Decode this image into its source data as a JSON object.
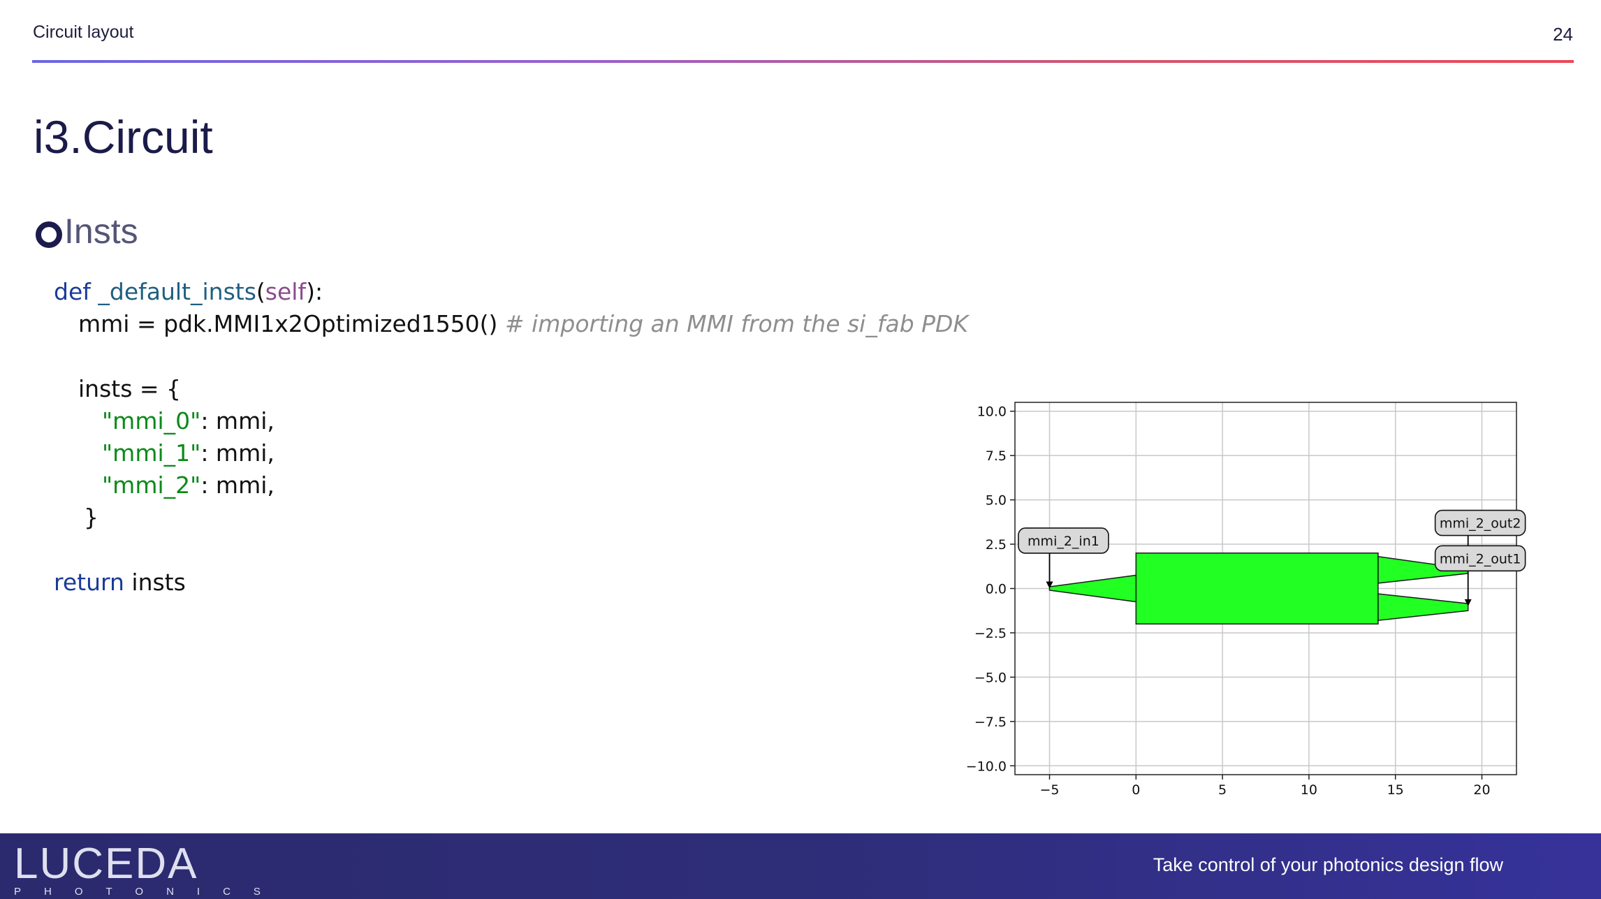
{
  "header": {
    "title": "Circuit layout",
    "page_number": "24"
  },
  "slide_title": "i3.Circuit",
  "section": {
    "heading": "Insts"
  },
  "code": {
    "l1_kw": "def",
    "l1_fn": "_default_insts",
    "l1_p1": "(",
    "l1_self": "self",
    "l1_p2": "):",
    "l2_code": "mmi = pdk.MMI1x2Optimized1550() ",
    "l2_comment": "# importing an MMI from the si_fab PDK",
    "l4": "insts = {",
    "l5_str": "\"mmi_0\"",
    "l5_rest": ": mmi,",
    "l6_str": "\"mmi_1\"",
    "l6_rest": ": mmi,",
    "l7_str": "\"mmi_2\"",
    "l7_rest": ": mmi,",
    "l8": "}",
    "l10_kw": "return",
    "l10_rest": " insts"
  },
  "chart_data": {
    "type": "layout-plot",
    "xlim": [
      -7,
      22
    ],
    "ylim": [
      -10.5,
      10.5
    ],
    "x_ticks": [
      -5,
      0,
      5,
      10,
      15,
      20
    ],
    "x_tick_labels": [
      "−5",
      "0",
      "5",
      "10",
      "15",
      "20"
    ],
    "y_ticks": [
      10,
      7.5,
      5,
      2.5,
      0,
      -2.5,
      -5,
      -7.5,
      -10
    ],
    "y_tick_labels": [
      "10.0",
      "7.5",
      "5.0",
      "2.5",
      "0.0",
      "−2.5",
      "−5.0",
      "−7.5",
      "−10.0"
    ],
    "grid": true,
    "fill_color": "#22ff22",
    "shapes": [
      {
        "name": "mmi-body",
        "points": [
          [
            0,
            2
          ],
          [
            14,
            2
          ],
          [
            14,
            -2
          ],
          [
            0,
            -2
          ]
        ]
      },
      {
        "name": "input-taper",
        "points": [
          [
            -5,
            0.1
          ],
          [
            0,
            0.75
          ],
          [
            0,
            -0.75
          ],
          [
            -5,
            -0.1
          ]
        ]
      },
      {
        "name": "output-taper-top",
        "points": [
          [
            14,
            1.8
          ],
          [
            19.2,
            1.1
          ],
          [
            19.2,
            0.85
          ],
          [
            14,
            0.3
          ]
        ]
      },
      {
        "name": "output-taper-bottom",
        "points": [
          [
            14,
            -0.3
          ],
          [
            19.2,
            -0.85
          ],
          [
            19.2,
            -1.25
          ],
          [
            14,
            -1.8
          ]
        ]
      }
    ],
    "ports": [
      {
        "label": "mmi_2_in1",
        "x": -5,
        "y": 0,
        "label_x": -6.8,
        "label_y": 2.7
      },
      {
        "label": "mmi_2_out2",
        "x": 19.2,
        "y": 1.0,
        "label_x": 17.3,
        "label_y": 3.7
      },
      {
        "label": "mmi_2_out1",
        "x": 19.2,
        "y": -1.0,
        "label_x": 17.3,
        "label_y": 1.7
      }
    ]
  },
  "footer": {
    "logo_text": "LUCEDA",
    "logo_subtext": "PHOTONICS",
    "tagline": "Take control of your photonics design flow"
  }
}
